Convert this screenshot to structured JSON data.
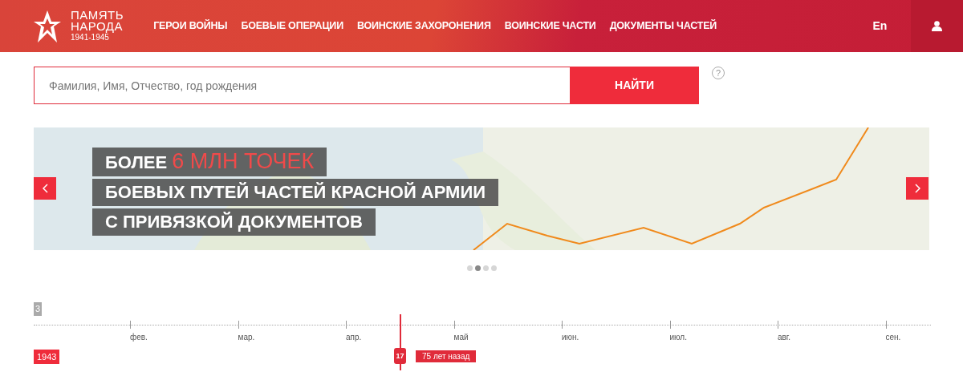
{
  "header": {
    "logo": {
      "line1": "ПАМЯТЬ",
      "line2": "НАРОДА",
      "years": "1941-1945"
    },
    "nav": [
      {
        "label": "ГЕРОИ ВОЙНЫ"
      },
      {
        "label": "БОЕВЫЕ ОПЕРАЦИИ"
      },
      {
        "label": "ВОИНСКИЕ ЗАХОРОНЕНИЯ"
      },
      {
        "label": "ВОИНСКИЕ ЧАСТИ"
      },
      {
        "label": "ДОКУМЕНТЫ ЧАСТЕЙ"
      }
    ],
    "language": "En"
  },
  "search": {
    "placeholder": "Фамилия, Имя, Отчество, год рождения",
    "button": "НАЙТИ",
    "help": "?"
  },
  "carousel": {
    "lines": [
      {
        "parts": [
          {
            "text": "БОЛЕЕ",
            "accent": false
          },
          {
            "text": "6 МЛН ТОЧЕК",
            "accent": true
          }
        ]
      },
      {
        "parts": [
          {
            "text": "БОЕВЫХ ПУТЕЙ ЧАСТЕЙ КРАСНОЙ АРМИИ",
            "accent": false
          }
        ]
      },
      {
        "parts": [
          {
            "text": "С ПРИВЯЗКОЙ ДОКУМЕНТОВ",
            "accent": false
          }
        ]
      }
    ],
    "indicators": [
      {
        "selected": false
      },
      {
        "selected": true
      },
      {
        "selected": false
      },
      {
        "selected": false
      }
    ]
  },
  "timeline": {
    "clipped_label": "3",
    "months": [
      "фев.",
      "мар.",
      "апр.",
      "май",
      "июн.",
      "июл.",
      "авг.",
      "сен."
    ],
    "year": "1943",
    "marker_day": "17",
    "ago": "75 лет назад"
  }
}
